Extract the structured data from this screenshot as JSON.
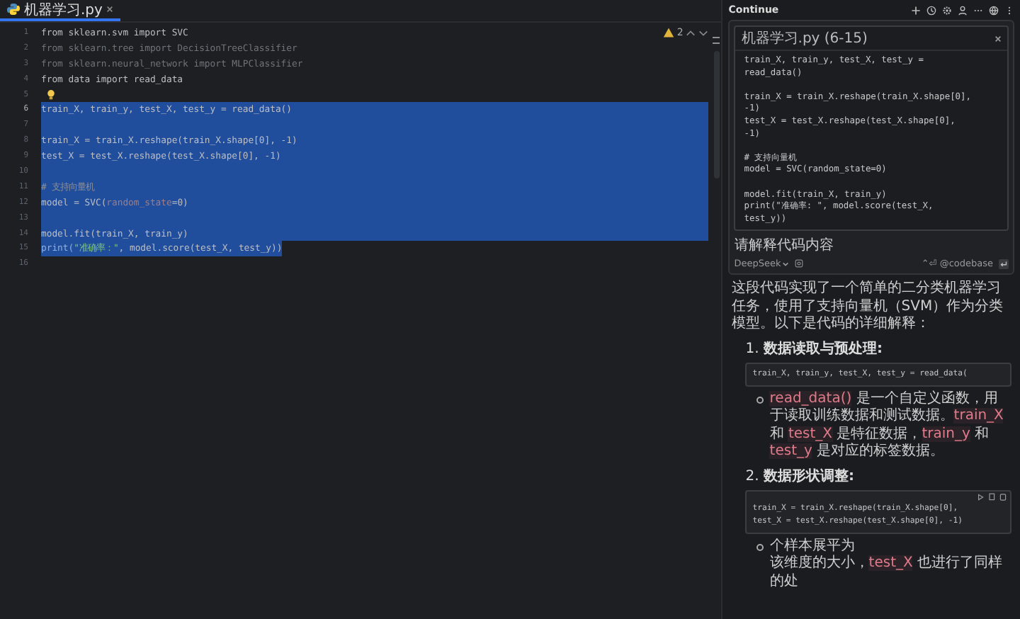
{
  "editor": {
    "tab": {
      "title": "机器学习.py",
      "selected": true
    },
    "inspections": {
      "count": "2"
    },
    "lines": [
      {
        "number": "1",
        "current": false,
        "bulb": false,
        "selected": false,
        "parts": [
          {
            "text": "from sklearn.svm import SVC",
            "kind": "code"
          }
        ]
      },
      {
        "number": "2",
        "current": false,
        "bulb": false,
        "selected": false,
        "parts": [
          {
            "text": "from sklearn.tree import DecisionTreeClassifier",
            "kind": "unused"
          }
        ]
      },
      {
        "number": "3",
        "current": false,
        "bulb": false,
        "selected": false,
        "parts": [
          {
            "text": "from sklearn.neural_network import MLPClassifier",
            "kind": "unused"
          }
        ]
      },
      {
        "number": "4",
        "current": false,
        "bulb": false,
        "selected": false,
        "parts": [
          {
            "text": "from data import read_data",
            "kind": "code"
          }
        ]
      },
      {
        "number": "5",
        "current": false,
        "bulb": true,
        "selected": false
      },
      {
        "number": "6",
        "current": true,
        "bulb": false,
        "selected": true,
        "parts": [
          {
            "text": "train_X, train_y, test_X, test_y = read_data()",
            "kind": "code"
          }
        ]
      },
      {
        "number": "7",
        "current": false,
        "bulb": false,
        "selected": true
      },
      {
        "number": "8",
        "current": false,
        "bulb": false,
        "selected": true,
        "parts": [
          {
            "text": "train_X = train_X.reshape(train_X.shape[0], -1)",
            "kind": "code"
          }
        ]
      },
      {
        "number": "9",
        "current": false,
        "bulb": false,
        "selected": true,
        "parts": [
          {
            "text": "test_X = test_X.reshape(test_X.shape[0], -1)",
            "kind": "code"
          }
        ]
      },
      {
        "number": "10",
        "current": false,
        "bulb": false,
        "selected": true
      },
      {
        "number": "11",
        "current": false,
        "bulb": false,
        "selected": true,
        "parts": [
          {
            "text": "# 支持向量机",
            "kind": "comment"
          }
        ]
      },
      {
        "number": "12",
        "current": false,
        "bulb": false,
        "selected": true,
        "parts": [
          {
            "text": "model = SVC(",
            "kind": "code"
          },
          {
            "text": "random_state",
            "kind": "hint"
          },
          {
            "text": "=0)",
            "kind": "code"
          }
        ]
      },
      {
        "number": "13",
        "current": false,
        "bulb": false,
        "selected": true
      },
      {
        "number": "14",
        "current": false,
        "bulb": false,
        "selected": true,
        "parts": [
          {
            "text": "model.fit(train_X, train_y)",
            "kind": "code"
          }
        ]
      },
      {
        "number": "15",
        "current": false,
        "bulb": false,
        "selected": true,
        "parts": [
          {
            "text": "print(",
            "kind": "builtin"
          },
          {
            "text": "\"准确率：\"",
            "kind": "string"
          },
          {
            "text": ", model.score(test_X, test_y))",
            "kind": "code"
          }
        ]
      },
      {
        "number": "16",
        "current": false,
        "bulb": false,
        "selected": false
      }
    ]
  },
  "chat": {
    "title": "Continue",
    "context": {
      "file": "机器学习.py (6-15)",
      "code": [
        [
          "train_X, train_y, test_X, test_y =",
          "read_data()"
        ],
        [
          "train_X = train_X.reshape(train_X.shape[0],",
          "-1)",
          "test_X = test_X.reshape(test_X.shape[0],",
          "-1)"
        ],
        [
          "# 支持向量机",
          "model = SVC(random_state=0)"
        ],
        [
          "model.fit(train_X, train_y)",
          "print(\"准确率: \", model.score(test_X,",
          "test_y))"
        ]
      ]
    },
    "prompt": "请解释代码内容",
    "model": "DeepSeek",
    "shortcut": "⌃⏎ @codebase",
    "answer": {
      "intro": "这段代码实现了一个简单的二分类机器学习任务，使用了支持向量机（SVM）作为分类模型。以下是代码的详细解释：",
      "sections": [
        {
          "number": "1.",
          "heading": "数据读取与预处理:",
          "toolbar": false,
          "code": [
            "train_X, train_y, test_X, test_y = read_data("
          ],
          "bullets": [
            [
              [
                {
                  "text": "read_data()",
                  "kind": "code"
                },
                {
                  "text": " 是一个自定义函数，用于读取训练数据和测试数据。",
                  "kind": "text"
                },
                {
                  "text": "train_X",
                  "kind": "code"
                },
                {
                  "text": " 和 ",
                  "kind": "text"
                },
                {
                  "text": "test_X",
                  "kind": "code"
                },
                {
                  "text": " 是特征数据，",
                  "kind": "text"
                },
                {
                  "text": "train_y",
                  "kind": "code"
                },
                {
                  "text": " 和 ",
                  "kind": "text"
                },
                {
                  "text": "test_y",
                  "kind": "code"
                },
                {
                  "text": " 是对应的标签数据。",
                  "kind": "text"
                }
              ]
            ]
          ]
        },
        {
          "number": "2.",
          "heading": "数据形状调整:",
          "toolbar": true,
          "code": [
            "train_X = train_X.reshape(train_X.shape[0],",
            "test_X = test_X.reshape(test_X.shape[0], -1)"
          ],
          "bullets": [
            [
              [
                {
                  "text": "个样本展平为",
                  "kind": "text"
                }
              ],
              [
                {
                  "text": "该维度的大小，",
                  "kind": "text"
                },
                {
                  "text": "test_X",
                  "kind": "code"
                },
                {
                  "text": " 也进行了同样的处",
                  "kind": "text"
                }
              ]
            ]
          ]
        }
      ]
    }
  }
}
